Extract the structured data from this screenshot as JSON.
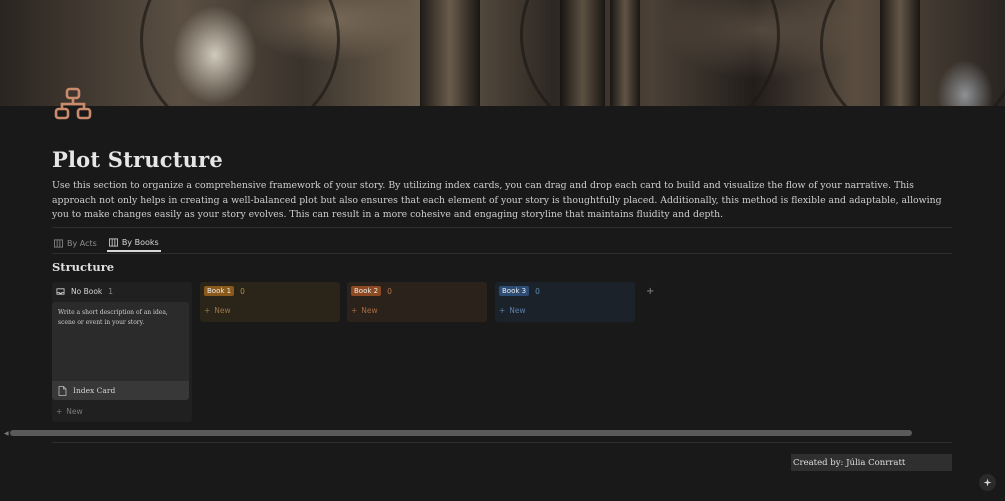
{
  "page": {
    "title": "Plot Structure",
    "description": "Use this section to organize a comprehensive framework of your story. By utilizing index cards, you can drag and drop each card to build and visualize the flow of your narrative. This approach not only helps in creating a well-balanced plot but also ensures that each element of your story is thoughtfully placed. Additionally, this method is flexible and adaptable, allowing you to make changes easily as your story evolves. This can result in a more cohesive and engaging storyline that maintains fluidity and depth.",
    "icon": "org-chart-icon",
    "accent": "#c98b6b"
  },
  "tabs": [
    {
      "label": "By Acts",
      "icon": "table-icon",
      "active": false
    },
    {
      "label": "By Books",
      "icon": "table-icon",
      "active": true
    }
  ],
  "section_title": "Structure",
  "columns": [
    {
      "label": "No Book",
      "count": "1",
      "tag_color": "",
      "bg": "#202020",
      "text_color": "#d4d4d4",
      "new_color": "#7a7a7a"
    },
    {
      "label": "Book 1",
      "count": "0",
      "tag_color": "#8a5a1c",
      "bg": "#2a2419",
      "text_color": "#b08a55",
      "new_color": "#9a7746"
    },
    {
      "label": "Book 2",
      "count": "0",
      "tag_color": "#8d4a22",
      "bg": "#2b221c",
      "text_color": "#b5774e",
      "new_color": "#a66b45"
    },
    {
      "label": "Book 3",
      "count": "0",
      "tag_color": "#2d4c73",
      "bg": "#1c2229",
      "text_color": "#5f87b8",
      "new_color": "#5c7fa9"
    }
  ],
  "card": {
    "text": "Write a short description of an idea, scene or event in your story.",
    "footer_label": "Index Card",
    "footer_icon": "document-icon"
  },
  "new_label": "New",
  "add_column_icon": "plus-icon",
  "credit": "Created by: Júlia Conrratt",
  "help_icon": "sparkle-icon"
}
